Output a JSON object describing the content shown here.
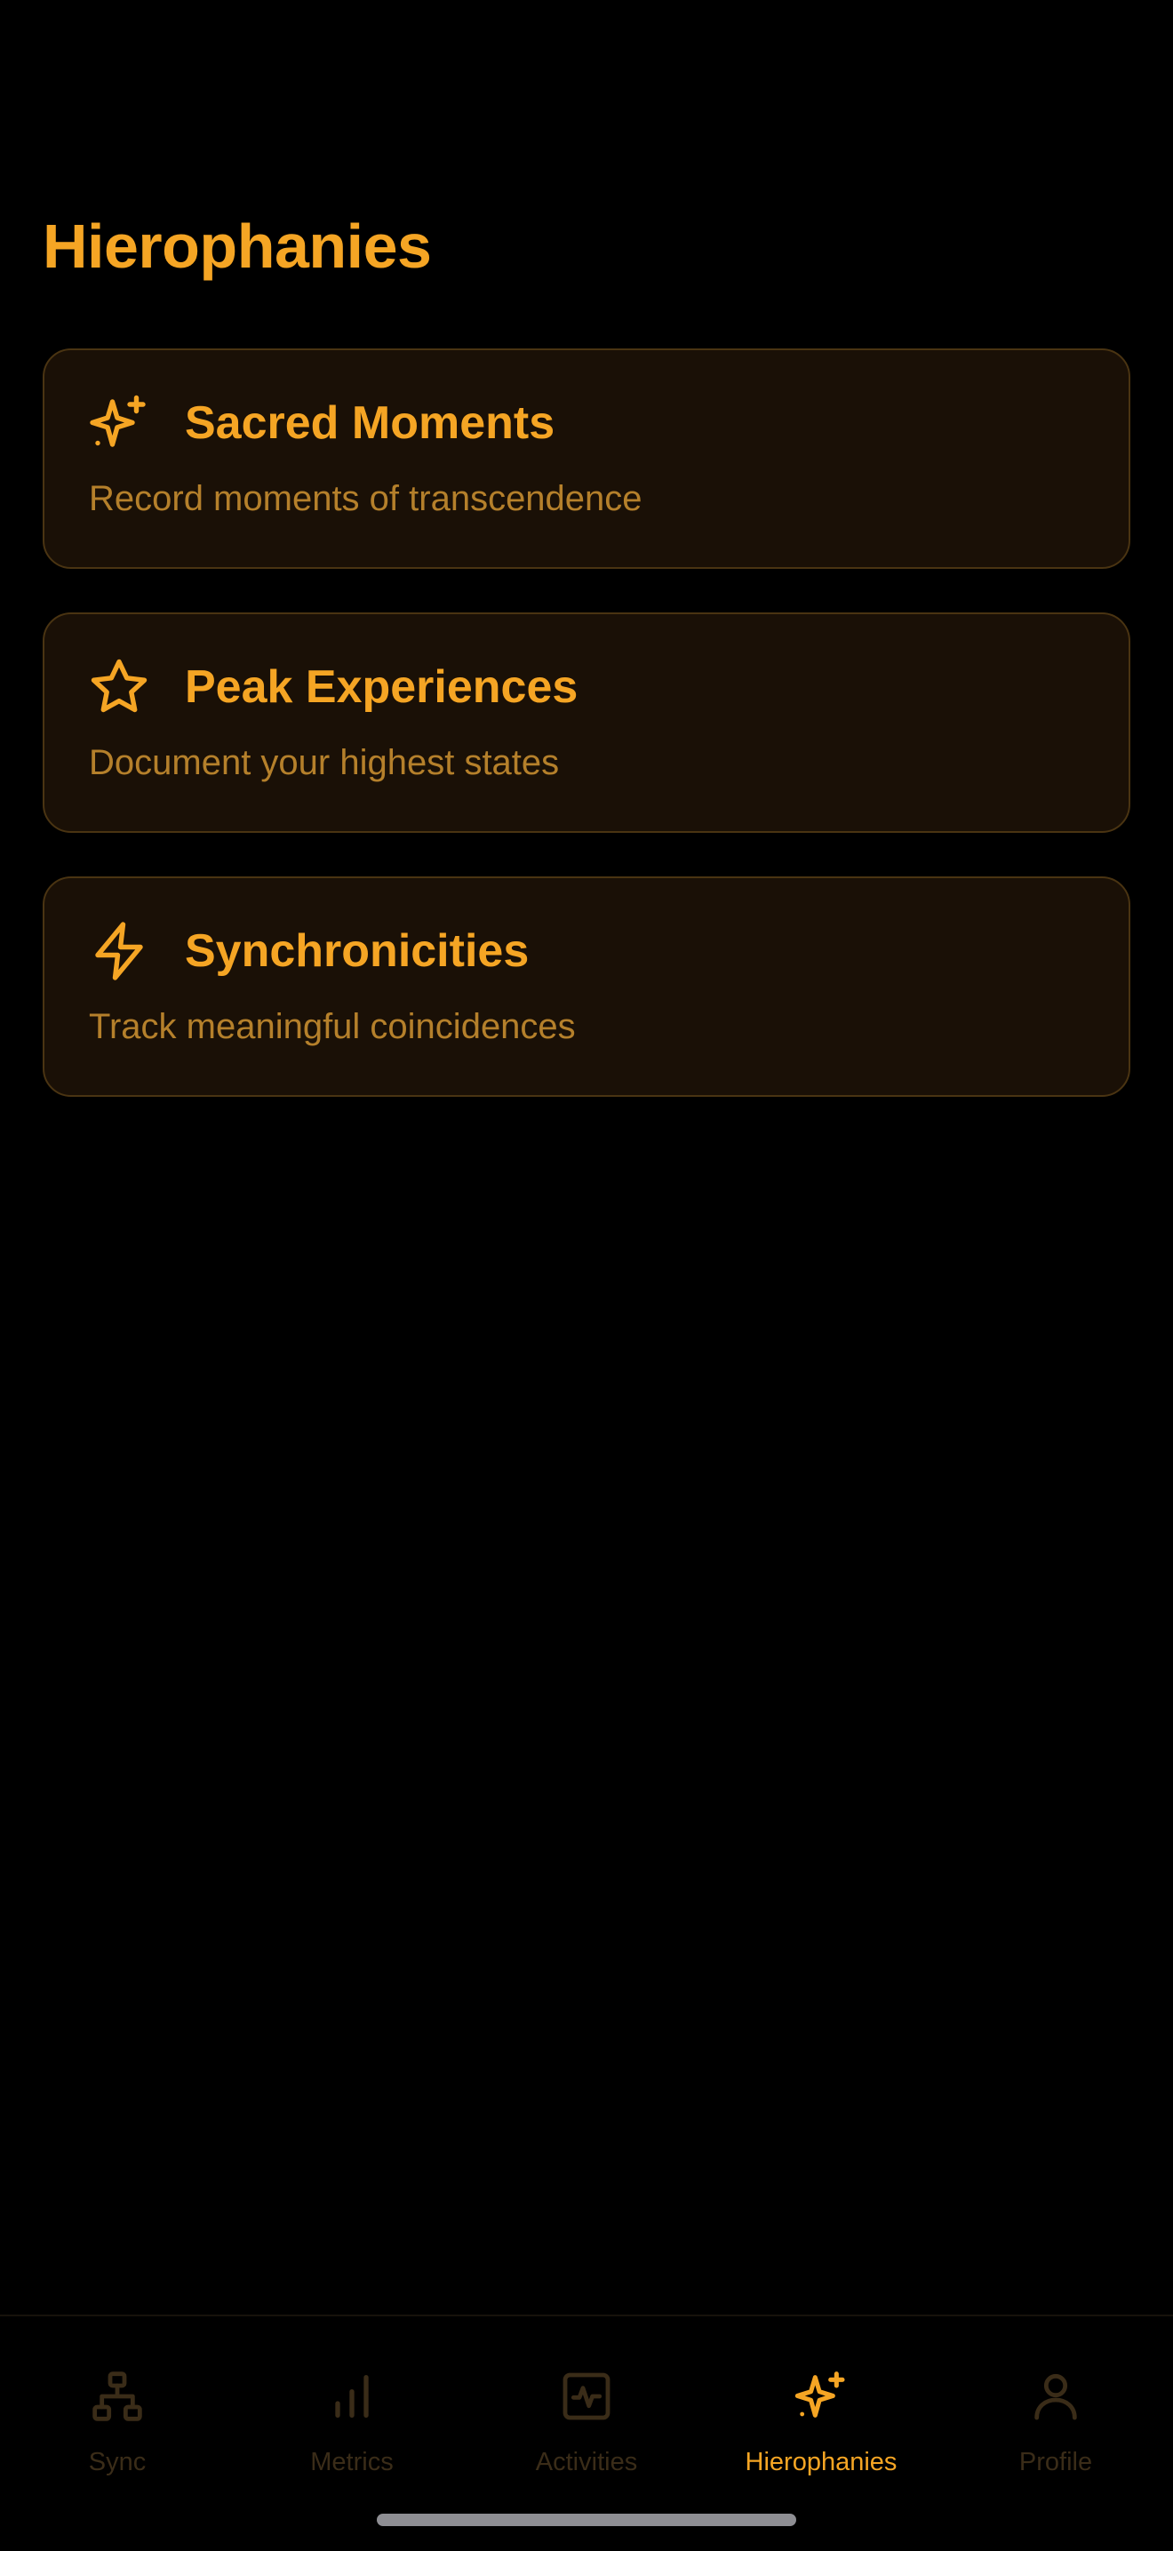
{
  "page": {
    "title": "Hierophanies"
  },
  "cards": [
    {
      "icon": "sparkles-icon",
      "title": "Sacred Moments",
      "subtitle": "Record moments of transcendence"
    },
    {
      "icon": "star-icon",
      "title": "Peak Experiences",
      "subtitle": "Document your highest states"
    },
    {
      "icon": "lightning-icon",
      "title": "Synchronicities",
      "subtitle": "Track meaningful coincidences"
    }
  ],
  "tabbar": {
    "tabs": [
      {
        "label": "Sync",
        "icon": "network-icon",
        "active": false
      },
      {
        "label": "Metrics",
        "icon": "bar-chart-icon",
        "active": false
      },
      {
        "label": "Activities",
        "icon": "activity-icon",
        "active": false
      },
      {
        "label": "Hierophanies",
        "icon": "sparkles-icon",
        "active": true
      },
      {
        "label": "Profile",
        "icon": "user-icon",
        "active": false
      }
    ]
  },
  "colors": {
    "background": "#000000",
    "accent": "#F5A524",
    "card_background": "#1A1006",
    "card_border": "#4A3412",
    "subtitle": "#B5802B",
    "inactive_tab": "#3A2C18"
  }
}
